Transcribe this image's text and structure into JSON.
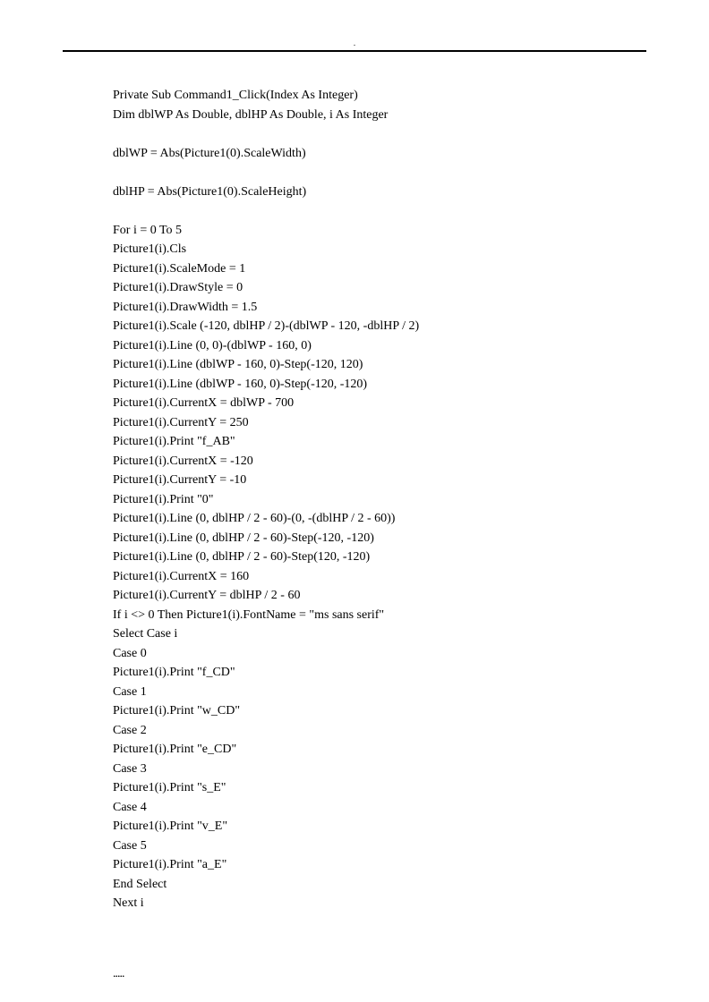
{
  "header": {
    "dot": "."
  },
  "code": {
    "lines": [
      "Private Sub Command1_Click(Index As Integer)",
      "Dim dblWP As Double, dblHP As Double, i As Integer",
      "",
      "dblWP = Abs(Picture1(0).ScaleWidth)",
      "",
      "dblHP = Abs(Picture1(0).ScaleHeight)",
      "",
      "For i = 0 To 5",
      "Picture1(i).Cls",
      "Picture1(i).ScaleMode = 1",
      "Picture1(i).DrawStyle = 0",
      "Picture1(i).DrawWidth = 1.5",
      "Picture1(i).Scale (-120, dblHP / 2)-(dblWP - 120, -dblHP / 2)",
      "Picture1(i).Line (0, 0)-(dblWP - 160, 0)",
      "Picture1(i).Line (dblWP - 160, 0)-Step(-120, 120)",
      "Picture1(i).Line (dblWP - 160, 0)-Step(-120, -120)",
      "Picture1(i).CurrentX = dblWP - 700",
      "Picture1(i).CurrentY = 250",
      "Picture1(i).Print \"f_AB\"",
      "Picture1(i).CurrentX = -120",
      "Picture1(i).CurrentY = -10",
      "Picture1(i).Print \"0\"",
      "Picture1(i).Line (0, dblHP / 2 - 60)-(0, -(dblHP / 2 - 60))",
      "Picture1(i).Line (0, dblHP / 2 - 60)-Step(-120, -120)",
      "Picture1(i).Line (0, dblHP / 2 - 60)-Step(120, -120)",
      "Picture1(i).CurrentX = 160",
      "Picture1(i).CurrentY = dblHP / 2 - 60",
      "If i <> 0 Then Picture1(i).FontName = \"ms sans serif\"",
      "Select Case i",
      "Case 0",
      "Picture1(i).Print \"f_CD\"",
      "Case 1",
      "Picture1(i).Print \"w_CD\"",
      "Case 2",
      "Picture1(i).Print \"e_CD\"",
      "Case 3",
      "Picture1(i).Print \"s_E\"",
      "Case 4",
      "Picture1(i).Print \"v_E\"",
      "Case 5",
      "Picture1(i).Print \"a_E\"",
      "End Select",
      "Next i"
    ]
  },
  "footer": {
    "ellipsis": "....."
  }
}
